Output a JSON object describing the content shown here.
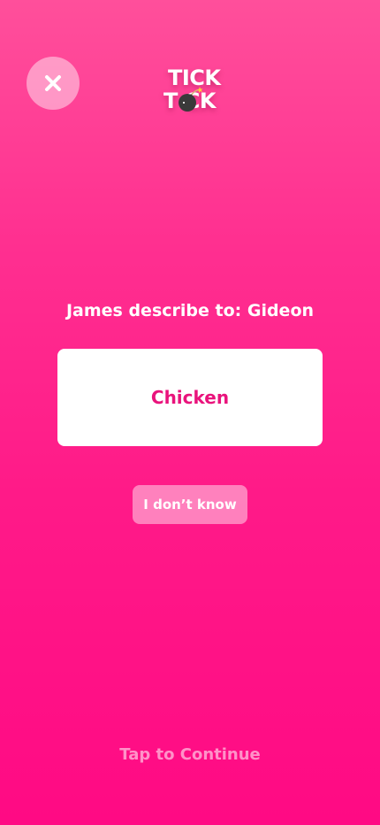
{
  "header": {
    "close_icon": "close-icon",
    "logo": {
      "line1": "TICK",
      "line2": "T   CK",
      "bomb_icon": "bomb-icon"
    }
  },
  "game": {
    "prompt": "James describe to: Gideon",
    "word": "Chicken",
    "dont_know_label": "I don’t know",
    "continue_label": "Tap to Continue"
  },
  "colors": {
    "background_top": "#ff4f9b",
    "background_bottom": "#ff0a84",
    "word_text": "#e9137c",
    "card": "#ffffff"
  }
}
